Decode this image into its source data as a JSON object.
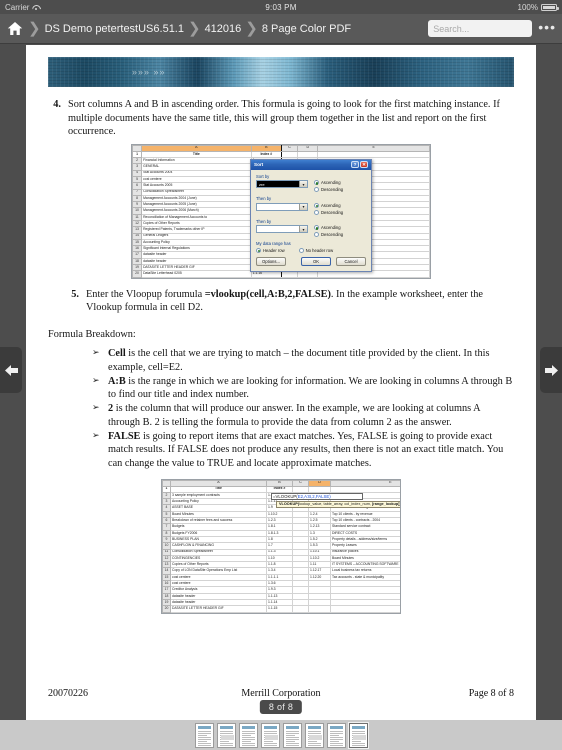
{
  "statusbar": {
    "carrier": "Carrier",
    "wifi_icon": "wifi-icon",
    "time": "9:03 PM",
    "battery_percent": "100%",
    "battery_icon": "battery-full-icon"
  },
  "navbar": {
    "home_icon": "home-icon",
    "breadcrumbs": [
      {
        "label": "DS Demo petertestUS6.51.1"
      },
      {
        "label": "412016"
      },
      {
        "label": "8 Page Color PDF"
      }
    ],
    "separator": "❯",
    "search": {
      "value": "",
      "placeholder": "Search..."
    },
    "more_icon": "ellipsis-icon",
    "more_label": "•••"
  },
  "nav": {
    "prev_icon": "arrow-left-icon",
    "prev_glyph": "←",
    "next_icon": "arrow-right-icon",
    "next_glyph": "→"
  },
  "viewer": {
    "page_badge": "8 of 8",
    "thumbnail_count": 8,
    "current_thumbnail": 8
  },
  "document": {
    "banner_alt": "blue technology header banner",
    "step4": {
      "number": "4.",
      "text": "Sort columns A and B in ascending order. This formula is going to look for the first matching instance. If multiple documents have the same title, this will group them together in the list and report on the first occurrence."
    },
    "step5": {
      "number": "5.",
      "pre": "Enter the Vloopup forumula ",
      "formula": "=vlookup(cell,A:B,2,FALSE)",
      "post": ". In the example worksheet, enter the Vlookup formula in cell D2."
    },
    "breakdown_heading": "Formula Breakdown:",
    "bullets": [
      {
        "marker": "➢",
        "term": "Cell",
        "text": " is the cell that we are trying to match – the document title provided by the client. In this example, cell=E2."
      },
      {
        "marker": "➢",
        "term": "A:B",
        "text": " is the range in which we are looking for information. We are looking in columns A through B to find our title and index number."
      },
      {
        "marker": "➢",
        "term": "2",
        "text": " is the column that will produce our answer. In the example, we are looking at columns A through B. 2 is telling the formula to provide the data from column 2 as the answer."
      },
      {
        "marker": "➢",
        "term": "FALSE",
        "text": " is going to report items that are exact matches. Yes, FALSE is going to provide exact match results. If FALSE does not produce any results, then there is not an exact title match. You can change the value to TRUE and locate approximate matches."
      }
    ],
    "footer": {
      "left": "20070226",
      "center": "Merrill Corporation",
      "right": "Page 8 of 8"
    }
  },
  "sheet1": {
    "column_headers": [
      "A",
      "B",
      "C",
      "D",
      "E"
    ],
    "title_row": {
      "a": "Title",
      "b": "Index #"
    },
    "rows": [
      {
        "n": "2",
        "a": "Financial Information",
        "b": "1",
        "e": ""
      },
      {
        "n": "3",
        "a": "GENERAL",
        "b": "1.1",
        "e": "(June)"
      },
      {
        "n": "4",
        "a": "Stat Accounts 2004",
        "b": "1.1.1",
        "e": "(March)"
      },
      {
        "n": "5",
        "a": "cost centere",
        "b": "1.1.1.1",
        "e": "nt Accounts to IFRS"
      },
      {
        "n": "6",
        "a": "Stat Accounts 2005",
        "b": "1.1.2",
        "e": ""
      },
      {
        "n": "7",
        "a": "Consolidation Spreadsheet",
        "b": "1.1.3",
        "e": ""
      },
      {
        "n": "8",
        "a": "Management Accounts 2004 (June)",
        "b": "1.1.4",
        "e": "2004"
      },
      {
        "n": "9",
        "a": "Management Accounts 2005 (June)",
        "b": "1.1.5",
        "e": ""
      },
      {
        "n": "10",
        "a": "Management Accounts 2006 (March)",
        "b": "1.1.6",
        "e": ""
      },
      {
        "n": "11",
        "a": "Reconciliation of Management Accounts to",
        "b": "1.1.7",
        "e": "ze/terms"
      },
      {
        "n": "12",
        "a": "Copies of Other Reports",
        "b": "1.1.8",
        "e": ""
      },
      {
        "n": "13",
        "a": "Registered Patents, Trademarks other IP",
        "b": "1.1.9",
        "e": ""
      },
      {
        "n": "14",
        "a": "General Ledgers",
        "b": "1.1.10",
        "e": ""
      },
      {
        "n": "15",
        "a": "Accounting Policy",
        "b": "1.1.11",
        "e": "G SOFTWARE"
      },
      {
        "n": "16",
        "a": "Significant Internal Regulations",
        "b": "1.1.12",
        "e": ""
      },
      {
        "n": "17",
        "a": "datasite header",
        "b": "1.1.13",
        "e": "cipality"
      },
      {
        "n": "18",
        "a": "datasite header",
        "b": "1.1.14",
        "e": ""
      },
      {
        "n": "19",
        "a": "DATASITE LETTER HEADER GIF",
        "b": "1.1.15",
        "e": ""
      },
      {
        "n": "20",
        "a": "DataSite Letterhead 0205",
        "b": "1.1.16",
        "e": ""
      }
    ],
    "sort_dialog": {
      "title": "Sort",
      "help_btn": "?",
      "close_btn": "✕",
      "sort_by_label": "Sort by",
      "sort_by_value": "zre",
      "then_by_label_1": "Then by",
      "then_by_value_1": "",
      "then_by_label_2": "Then by",
      "then_by_value_2": "",
      "ascending": "Ascending",
      "descending": "Descending",
      "range_label": "My data range has",
      "header_row": "Header row",
      "no_header_row": "No header row",
      "options_btn": "Options...",
      "ok_btn": "OK",
      "cancel_btn": "Cancel",
      "dropdown_arrow": "▾"
    }
  },
  "sheet2": {
    "column_headers": [
      "A",
      "B",
      "C",
      "D",
      "E"
    ],
    "title_row": {
      "a": "Title",
      "b": "Index #"
    },
    "formula_text": "=VLOOKUP(",
    "formula_args": "E2,A:B,2,FALSE)",
    "tooltip_fn": "VLOOKUP(",
    "tooltip_args": "lookup_value, table_array, col_index_num, ",
    "tooltip_bold": "[range_lookup])",
    "rows": [
      {
        "n": "2",
        "a": "3 sample employment contracts",
        "b": "1.12.14",
        "d": "",
        "e": ""
      },
      {
        "n": "3",
        "a": "Accounting Policy",
        "b": "1.1.11",
        "d": "",
        "e": ""
      },
      {
        "n": "4",
        "a": "ASSET BASE",
        "b": "1.9",
        "d": "1.1.7",
        "e": "Reconciliation of Management Accounts to IFRS"
      },
      {
        "n": "5",
        "a": "Board Minutes",
        "b": "1.10.2",
        "d": "1.2.4",
        "e": "Top 10 clients - by revenue"
      },
      {
        "n": "6",
        "a": "Breakdown of retainer fees and success",
        "b": "1.2.3",
        "d": "1.2.5",
        "e": "Top 10 clients - contracts - 2004"
      },
      {
        "n": "7",
        "a": "Budgets",
        "b": "1.8.1",
        "d": "1.2.13",
        "e": "Standard service contract"
      },
      {
        "n": "8",
        "a": "Budgets FY2006",
        "b": "1.8.1.3",
        "d": "1.3",
        "e": "DIRECT COSTS"
      },
      {
        "n": "9",
        "a": "BUSINESS PLAN",
        "b": "1.8",
        "d": "1.5.2",
        "e": "Property details - address/size/terms"
      },
      {
        "n": "10",
        "a": "CASHFLOW & FINANCING",
        "b": "1.7",
        "d": "1.5.3",
        "e": "Property Leases"
      },
      {
        "n": "11",
        "a": "Consolidation Spreadsheet",
        "b": "1.1.3",
        "d": "1.10.1",
        "e": "Insurance polices"
      },
      {
        "n": "12",
        "a": "CONTINGENCIES",
        "b": "1.10",
        "d": "1.10.2",
        "e": "Board Minutes"
      },
      {
        "n": "13",
        "a": "Copies of Other Reports",
        "b": "1.1.8",
        "d": "1.11",
        "e": "IT SYSTEMS – ACCOUNTING SOFTWARE"
      },
      {
        "n": "14",
        "a": "Copy of LON DataSite Operations Emp List",
        "b": "1.3.4",
        "d": "1.12.17",
        "e": "Local business tax returns"
      },
      {
        "n": "15",
        "a": "cost centere",
        "b": "1.1.1.1",
        "d": "1.12.20",
        "e": "Tax accounts - state & municipality"
      },
      {
        "n": "16",
        "a": "cost centere",
        "b": "1.3.6",
        "d": "",
        "e": ""
      },
      {
        "n": "17",
        "a": "Creditor Analysis",
        "b": "1.9.3",
        "d": "",
        "e": ""
      },
      {
        "n": "18",
        "a": "datasite header",
        "b": "1.1.13",
        "d": "",
        "e": ""
      },
      {
        "n": "19",
        "a": "datasite header",
        "b": "1.1.14",
        "d": "",
        "e": ""
      },
      {
        "n": "20",
        "a": "DATASITE LETTER HEADER GIF",
        "b": "1.1.15",
        "d": "",
        "e": ""
      }
    ]
  },
  "colors": {
    "chrome": "#4d4d4d",
    "navbar": "#595959",
    "page": "#ffffff",
    "selected_column": "#f5b36a",
    "thumbstrip": "#c9c9c9",
    "banner_blue": "#2b6280"
  }
}
